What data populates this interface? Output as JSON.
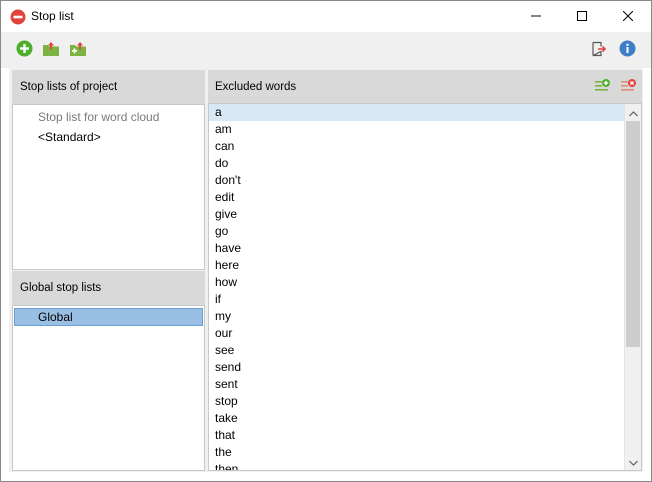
{
  "window": {
    "title": "Stop list"
  },
  "icons": {
    "title": "no-entry-icon",
    "minimize": "minimize-icon",
    "maximize": "maximize-icon",
    "close": "close-icon",
    "add": "plus-circle-icon",
    "import": "folder-upload-icon",
    "export": "folder-add-icon",
    "exit": "exit-icon",
    "info": "info-icon",
    "add_word": "list-add-icon",
    "remove_word": "list-remove-icon"
  },
  "colors": {
    "accent_green": "#4caf2a",
    "accent_red": "#e0443a",
    "info_blue": "#3c7fc8",
    "selection": "#99c0e4",
    "header_bg": "#d9d9d9"
  },
  "project_lists": {
    "header": "Stop lists of project",
    "items": [
      "Stop list for word cloud",
      "<Standard>"
    ]
  },
  "global_lists": {
    "header": "Global stop lists",
    "items": [
      "Global"
    ]
  },
  "excluded": {
    "header": "Excluded words",
    "words": [
      "a",
      "am",
      "can",
      "do",
      "don't",
      "edit",
      "give",
      "go",
      "have",
      "here",
      "how",
      "if",
      "my",
      "our",
      "see",
      "send",
      "sent",
      "stop",
      "take",
      "that",
      "the",
      "then"
    ]
  }
}
